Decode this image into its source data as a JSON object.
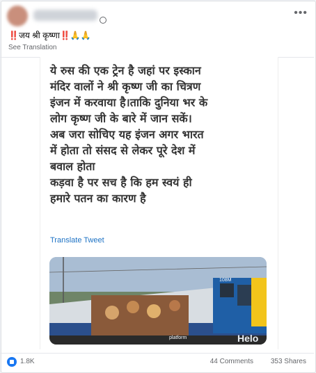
{
  "post": {
    "caption_marks_left": "‼️",
    "caption_text": "जय श्री कृष्णा",
    "caption_marks_right": "‼️",
    "caption_hands": "🙏🙏",
    "see_translation": "See Translation"
  },
  "tweet": {
    "lines": [
      "ये रुस की एक ट्रेन है जहां पर इस्कान",
      "मंदिर वालों ने श्री कृष्ण जी का चित्रण",
      "इंजन में करवाया है।ताकि दुनिया भर के",
      "लोग कृष्ण जी के बारे में जान सकें।",
      "अब जरा सोचिए यह इंजन अगर भारत",
      "में होता तो संसद से लेकर पूरे देश में",
      "बवाल होता",
      "कड़वा है पर सच है कि हम स्वयं ही",
      "हमारे पतन का कारण है"
    ],
    "translate_label": "Translate Tweet",
    "image_text": {
      "number": "108M",
      "brand": "Helo",
      "caption": "platform"
    }
  },
  "footer": {
    "reactions": "1.8K",
    "comments": "44 Comments",
    "shares": "353 Shares"
  },
  "colors": {
    "accent": "#1877f2",
    "link": "#1d72c4"
  }
}
